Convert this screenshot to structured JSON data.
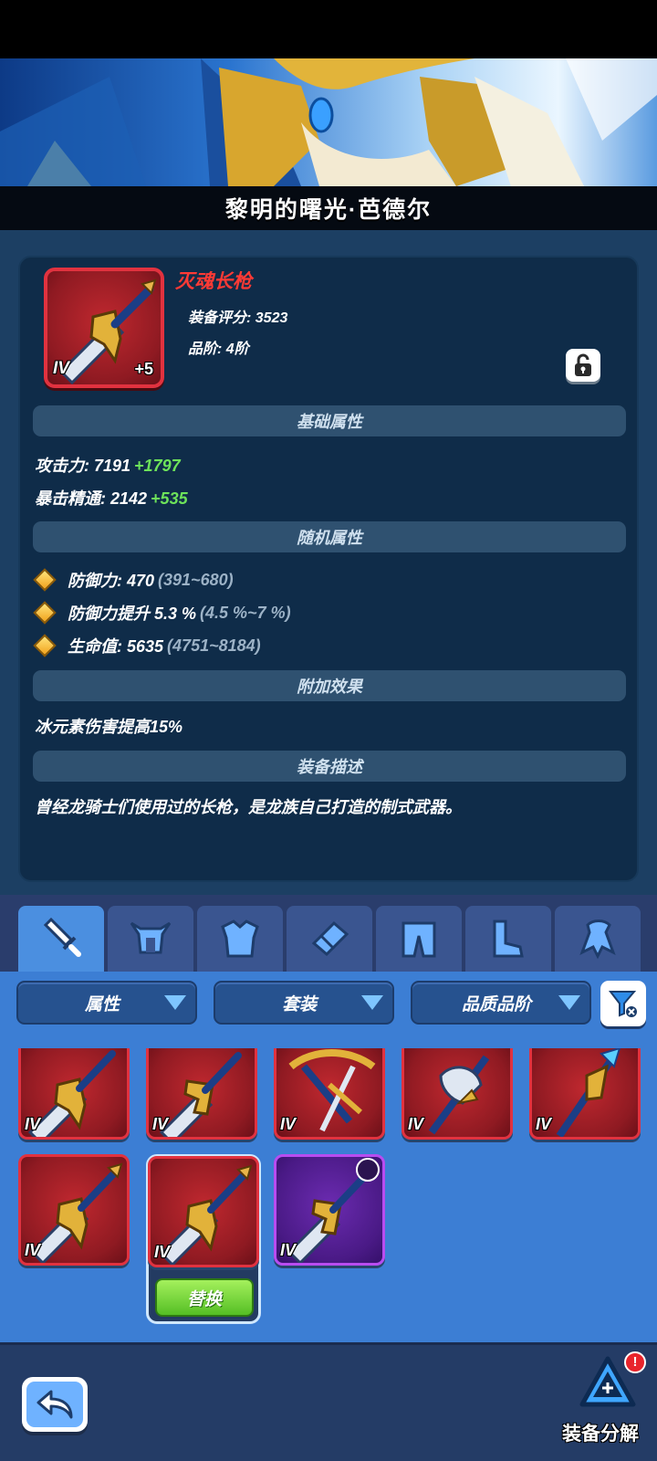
{
  "hero": {
    "name": "黎明的曙光·芭德尔"
  },
  "equipment": {
    "name": "灭魂长枪",
    "score_text": "装备评分: 3523",
    "grade_text": "品阶: 4阶",
    "tier": "IV",
    "enhance": "+5",
    "locked": false
  },
  "sections": {
    "base": "基础属性",
    "random": "随机属性",
    "bonus": "附加效果",
    "desc": "装备描述"
  },
  "base_stats": [
    {
      "label": "攻击力: 7191",
      "plus": "+1797"
    },
    {
      "label": "暴击精通: 2142",
      "plus": "+535"
    }
  ],
  "random_stats": [
    {
      "label": "防御力: 470",
      "range": "(391~680)"
    },
    {
      "label": "防御力提升 5.3 %",
      "range": "(4.5 %~7 %)"
    },
    {
      "label": "生命值: 5635",
      "range": "(4751~8184)"
    }
  ],
  "bonus_text": "冰元素伤害提高15%",
  "description": "曾经龙骑士们使用过的长枪，是龙族自己打造的制式武器。",
  "tabs": [
    {
      "icon": "sword-icon",
      "active": true
    },
    {
      "icon": "helmet-icon",
      "active": false
    },
    {
      "icon": "armor-icon",
      "active": false
    },
    {
      "icon": "bracer-icon",
      "active": false
    },
    {
      "icon": "pants-icon",
      "active": false
    },
    {
      "icon": "boots-icon",
      "active": false
    },
    {
      "icon": "cape-icon",
      "active": false
    }
  ],
  "filters": {
    "attr": "属性",
    "set": "套装",
    "quality": "品质品阶"
  },
  "inventory": {
    "row1_tiers": [
      "IV",
      "IV",
      "IV",
      "IV",
      "IV"
    ],
    "row2_tiers": [
      "IV",
      "IV",
      "IV"
    ],
    "replace_label": "替换"
  },
  "bottom": {
    "dismantle_label": "装备分解",
    "badge": "!"
  }
}
